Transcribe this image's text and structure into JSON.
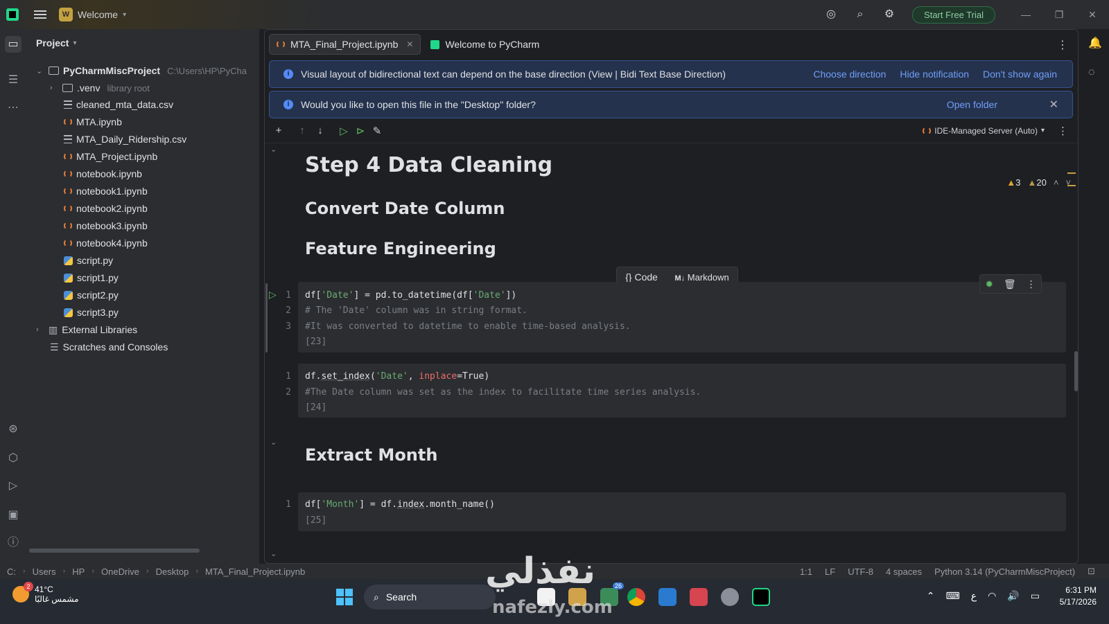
{
  "titlebar": {
    "project_badge": "W",
    "project_name": "Welcome",
    "trial_label": "Start Free Trial"
  },
  "project_panel": {
    "title": "Project",
    "root": {
      "name": "PyCharmMiscProject",
      "path": "C:\\Users\\HP\\PyCha"
    },
    "venv": {
      "name": ".venv",
      "hint": "library root"
    },
    "files": [
      {
        "name": "cleaned_mta_data.csv",
        "type": "csv"
      },
      {
        "name": "MTA.ipynb",
        "type": "notebook"
      },
      {
        "name": "MTA_Daily_Ridership.csv",
        "type": "csv"
      },
      {
        "name": "MTA_Project.ipynb",
        "type": "notebook"
      },
      {
        "name": "notebook.ipynb",
        "type": "notebook"
      },
      {
        "name": "notebook1.ipynb",
        "type": "notebook"
      },
      {
        "name": "notebook2.ipynb",
        "type": "notebook"
      },
      {
        "name": "notebook3.ipynb",
        "type": "notebook"
      },
      {
        "name": "notebook4.ipynb",
        "type": "notebook"
      },
      {
        "name": "script.py",
        "type": "python"
      },
      {
        "name": "script1.py",
        "type": "python"
      },
      {
        "name": "script2.py",
        "type": "python"
      },
      {
        "name": "script3.py",
        "type": "python"
      }
    ],
    "external_libraries": "External Libraries",
    "scratches": "Scratches and Consoles"
  },
  "tabs": [
    {
      "label": "MTA_Final_Project.ipynb",
      "active": true
    },
    {
      "label": "Welcome to PyCharm",
      "active": false
    }
  ],
  "banners": {
    "bidi": {
      "text": "Visual layout of bidirectional text can depend on the base direction (View | Bidi Text Base Direction)",
      "actions": [
        "Choose direction",
        "Hide notification",
        "Don't show again"
      ]
    },
    "folder": {
      "text": "Would you like to open this file in the \"Desktop\" folder?",
      "action": "Open folder"
    }
  },
  "notebook_toolbar": {
    "server": "IDE-Managed Server (Auto)"
  },
  "inspections": {
    "warnings": "3",
    "weak_warnings": "20"
  },
  "markdown": {
    "h_step4": "Step 4 Data Cleaning",
    "h_convert": "Convert Date Column",
    "h_feature": "Feature Engineering",
    "h_extract": "Extract Month"
  },
  "cell_popup": {
    "code": "Code",
    "markdown": "Markdown"
  },
  "cells": {
    "c1": {
      "l1": [
        "df[",
        "'Date'",
        "] = pd.to_datetime(df[",
        "'Date'",
        "])"
      ],
      "l2": "# The 'Date' column was in string format.",
      "l3": "#It was converted to datetime to enable time-based analysis.",
      "exec": "[23]"
    },
    "c2": {
      "l1": [
        "df.",
        "set_index",
        "(",
        "'Date'",
        ", ",
        "inplace",
        "=True)"
      ],
      "l2": "#The Date column was set as the index to facilitate time series analysis.",
      "exec": "[24]"
    },
    "c3": {
      "l1": [
        "df[",
        "'Month'",
        "] = df.",
        "index",
        ".month_name()"
      ],
      "exec": "[25]"
    }
  },
  "statusbar": {
    "crumbs": [
      "C:",
      "Users",
      "HP",
      "OneDrive",
      "Desktop",
      "MTA_Final_Project.ipynb"
    ],
    "position": "1:1",
    "line_sep": "LF",
    "encoding": "UTF-8",
    "indent": "4 spaces",
    "interpreter": "Python 3.14 (PyCharmMiscProject)"
  },
  "watermark": {
    "arabic": "نفذلي",
    "site": "nafezly.com"
  },
  "taskbar": {
    "weather_temp": "41°C",
    "weather_desc": "مشمس غالبًا",
    "weather_badge": "2",
    "search_label": "Search",
    "chrome_badge": "26",
    "lang": "ع",
    "time": "6:31 PM",
    "date": "5/17/2026"
  }
}
